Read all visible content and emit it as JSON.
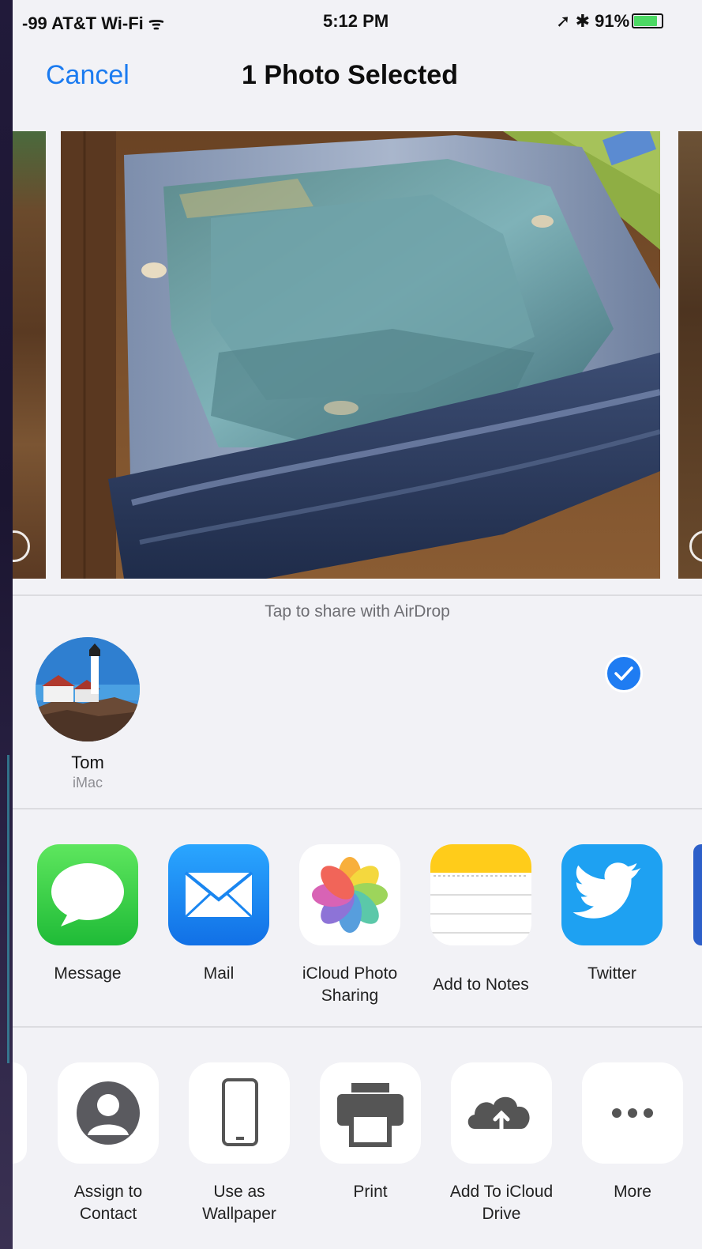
{
  "status_bar": {
    "carrier": "-99 AT&T Wi-Fi",
    "time": "5:12 PM",
    "battery": "91%",
    "battery_level": 0.91
  },
  "nav": {
    "cancel_label": "Cancel",
    "title": "1 Photo Selected"
  },
  "photo_strip": {
    "selected_index": 1
  },
  "airdrop": {
    "hint": "Tap to share with AirDrop",
    "contacts": [
      {
        "name": "Tom",
        "device": "iMac"
      }
    ]
  },
  "share_apps": [
    {
      "label": "Message",
      "icon": "messages-icon",
      "color": "#2fcf4a"
    },
    {
      "label": "Mail",
      "icon": "mail-icon",
      "color": "#1a8cf5"
    },
    {
      "label": "iCloud Photo Sharing",
      "icon": "photos-icon",
      "color": "#ffffff"
    },
    {
      "label": "Add to Notes",
      "icon": "notes-icon",
      "color": "#ffcc00"
    },
    {
      "label": "Twitter",
      "icon": "twitter-icon",
      "color": "#1da1f2"
    }
  ],
  "actions": [
    {
      "label": "Assign to Contact",
      "icon": "contact-icon"
    },
    {
      "label": "Use as Wallpaper",
      "icon": "phone-icon"
    },
    {
      "label": "Print",
      "icon": "printer-icon"
    },
    {
      "label": "Add To iCloud Drive",
      "icon": "cloud-upload-icon"
    },
    {
      "label": "More",
      "icon": "more-icon"
    }
  ]
}
